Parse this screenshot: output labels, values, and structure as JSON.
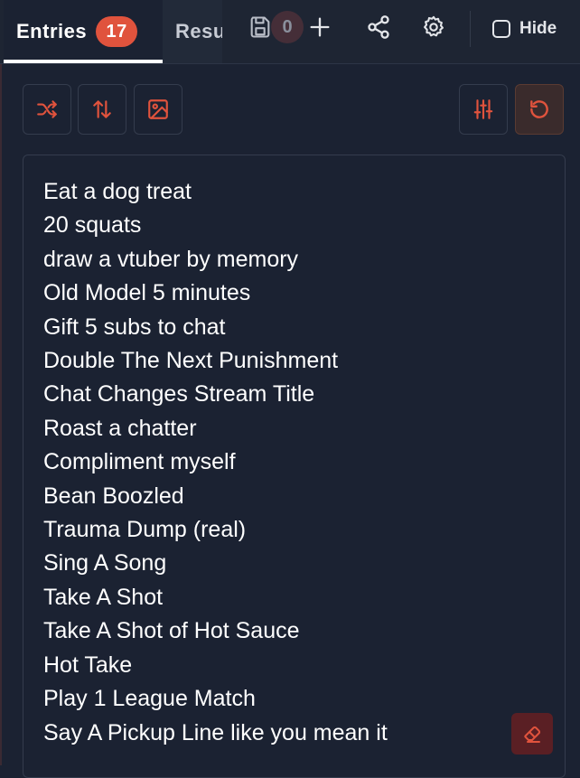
{
  "tabs": {
    "entries": {
      "label": "Entries",
      "count": "17"
    },
    "results": {
      "label": "Results",
      "count": "0"
    }
  },
  "header": {
    "hide_label": "Hide"
  },
  "toolbar": {
    "shuffle_icon": "shuffle-icon",
    "sort_icon": "sort-icon",
    "image_icon": "image-icon",
    "settings_icon": "sliders-icon",
    "reset_icon": "reset-icon"
  },
  "entries": [
    "Eat a dog treat",
    "20 squats",
    "draw a vtuber by memory",
    "Old Model 5 minutes",
    "Gift 5 subs to chat",
    "Double The Next Punishment",
    "Chat Changes Stream Title",
    "Roast a chatter",
    "Compliment myself",
    "Bean Boozled",
    "Trauma Dump (real)",
    "Sing A Song",
    "Take A Shot",
    "Take A Shot of Hot Sauce",
    "Hot Take",
    "Play 1 League Match",
    "Say A Pickup Line like you mean it"
  ],
  "colors": {
    "accent": "#e0533d",
    "background": "#1b2232",
    "border": "#343c4d",
    "erase": "#5a1f24"
  }
}
